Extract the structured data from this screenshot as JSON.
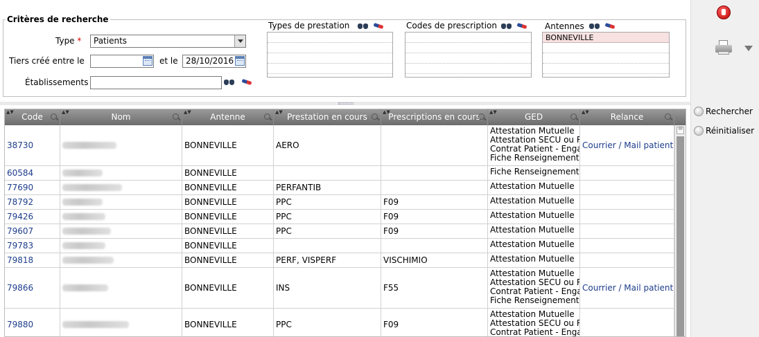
{
  "criteria": {
    "legend": "Critères de recherche",
    "type_label": "Type",
    "required_mark": "*",
    "type_value": "Patients",
    "tiers_label": "Tiers créé entre le",
    "date_from": "",
    "and_label": "et le",
    "date_to": "28/10/2016",
    "etab_label": "Établissements",
    "etab_value": ""
  },
  "lists": {
    "prestations_title": "Types de prestation",
    "prescriptions_title": "Codes de prescription",
    "antennes_title": "Antennes",
    "antennes_selected": "BONNEVILLE"
  },
  "grid": {
    "columns": [
      "Code",
      "Nom",
      "Antenne",
      "Prestation en cours",
      "Prescriptions en cours",
      "GED",
      "Relance"
    ],
    "rows": [
      {
        "code": "38730",
        "antenne": "BONNEVILLE",
        "prestation": "AERO",
        "prescription": "",
        "ged": [
          "Attestation Mutuelle",
          "Attestation SECU ou Re",
          "Contrat Patient - Enga",
          "Fiche Renseignement P"
        ],
        "relance": "Courrier / Mail patient"
      },
      {
        "code": "60584",
        "antenne": "BONNEVILLE",
        "prestation": "",
        "prescription": "",
        "ged": [
          "Fiche Renseignement P"
        ],
        "relance": ""
      },
      {
        "code": "77690",
        "antenne": "BONNEVILLE",
        "prestation": "PERFANTIB",
        "prescription": "",
        "ged": [
          "Attestation Mutuelle"
        ],
        "relance": ""
      },
      {
        "code": "78792",
        "antenne": "BONNEVILLE",
        "prestation": "PPC",
        "prescription": "F09",
        "ged": [
          "Attestation Mutuelle"
        ],
        "relance": ""
      },
      {
        "code": "79426",
        "antenne": "BONNEVILLE",
        "prestation": "PPC",
        "prescription": "F09",
        "ged": [
          "Attestation Mutuelle"
        ],
        "relance": ""
      },
      {
        "code": "79607",
        "antenne": "BONNEVILLE",
        "prestation": "PPC",
        "prescription": "F09",
        "ged": [
          "Attestation Mutuelle"
        ],
        "relance": ""
      },
      {
        "code": "79783",
        "antenne": "BONNEVILLE",
        "prestation": "",
        "prescription": "",
        "ged": [
          "Attestation Mutuelle"
        ],
        "relance": ""
      },
      {
        "code": "79818",
        "antenne": "BONNEVILLE",
        "prestation": "PERF, VISPERF",
        "prescription": "VISCHIMIO",
        "ged": [
          "Attestation Mutuelle"
        ],
        "relance": ""
      },
      {
        "code": "79866",
        "antenne": "BONNEVILLE",
        "prestation": "INS",
        "prescription": "F55",
        "ged": [
          "Attestation Mutuelle",
          "Attestation SECU ou Re",
          "Contrat Patient - Enga",
          "Fiche Renseignement P"
        ],
        "relance": "Courrier / Mail patient"
      },
      {
        "code": "79880",
        "antenne": "BONNEVILLE",
        "prestation": "PPC",
        "prescription": "F09",
        "ged": [
          "Attestation Mutuelle",
          "Attestation SECU ou Re",
          "Contrat Patient - Enga"
        ],
        "relance": ""
      }
    ]
  },
  "side": {
    "search_label": "Rechercher",
    "reset_label": "Réinitialiser"
  },
  "icons": {
    "stop": "stop-icon",
    "print": "printer-icon",
    "lookup": "binoculars-icon",
    "clear": "eraser-icon"
  }
}
